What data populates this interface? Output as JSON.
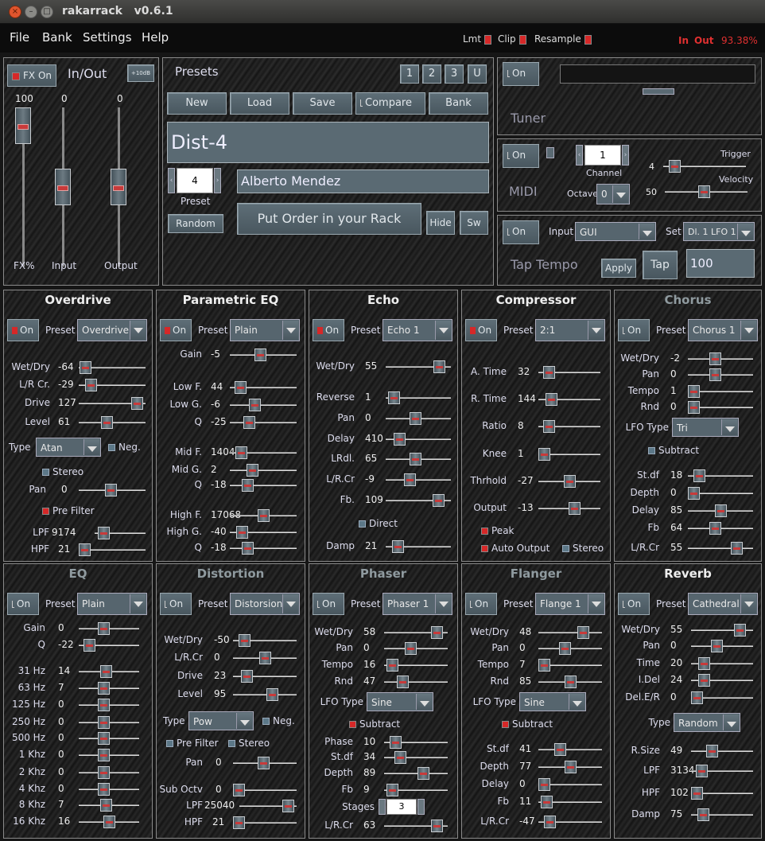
{
  "window": {
    "title": "rakarrack   v0.6.1",
    "close_glyph": "×",
    "min_glyph": "–",
    "max_glyph": "□"
  },
  "menu": [
    "File",
    "Bank",
    "Settings",
    "Help"
  ],
  "status": {
    "lmt": "Lmt",
    "clip": "Clip",
    "resample": "Resample",
    "in": "In",
    "out": "Out",
    "percent": "93.38%"
  },
  "inout": {
    "title": "In/Out",
    "fx_on": "FX On",
    "boost": "+10dB",
    "fx_val": "100",
    "input_val": "0",
    "output_val": "0",
    "fx_label": "FX%",
    "input_label": "Input",
    "output_label": "Output",
    "fx_level": 1.0,
    "input_level": 0.5,
    "output_level": 0.5
  },
  "presets": {
    "title": "Presets",
    "bank_buttons": [
      "1",
      "2",
      "3",
      "U"
    ],
    "new": "New",
    "load": "Load",
    "save": "Save",
    "compare": "Compare",
    "bank": "Bank",
    "name": "Dist-4",
    "number": "4",
    "preset_label": "Preset",
    "author": "Alberto Mendez",
    "random": "Random",
    "put_order": "Put Order in your Rack",
    "hide": "Hide",
    "sw": "Sw"
  },
  "tuner": {
    "on": "On",
    "label": "Tuner"
  },
  "midi": {
    "on": "On",
    "label": "MIDI",
    "channel": "1",
    "channel_label": "Channel",
    "octave_label": "Octave",
    "octave": "0",
    "trigger_label": "Trigger",
    "trigger": "4",
    "velocity_label": "Velocity",
    "velocity": "50"
  },
  "tap": {
    "on": "On",
    "input_label": "Input",
    "input": "GUI",
    "set_label": "Set",
    "set": "Dl. 1 LFO 1",
    "label": "Tap Tempo",
    "apply": "Apply",
    "tap": "Tap",
    "bpm": "100"
  },
  "effects_top": [
    {
      "title": "Overdrive",
      "dim": false,
      "preset": "Overdrive 1",
      "params": [
        {
          "l": "Wet/Dry",
          "v": "-64"
        },
        {
          "l": "L/R Cr.",
          "v": "-29"
        },
        {
          "l": "Drive",
          "v": "127"
        },
        {
          "l": "Level",
          "v": "61"
        }
      ],
      "type_label": "Type",
      "type": "Atan",
      "neg": "Neg.",
      "stereo": "Stereo",
      "pan_l": "Pan",
      "pan_v": "0",
      "prefilter": "Pre Filter",
      "lpf_l": "LPF",
      "lpf_v": "9174",
      "hpf_l": "HPF",
      "hpf_v": "21"
    },
    {
      "title": "Parametric EQ",
      "dim": false,
      "preset": "Plain",
      "params": [
        {
          "l": "Gain",
          "v": "-5"
        },
        {
          "l": "Low F.",
          "v": "44"
        },
        {
          "l": "Low G.",
          "v": "-6"
        },
        {
          "l": "Q",
          "v": "-25"
        },
        {
          "l": "Mid F.",
          "v": "1404"
        },
        {
          "l": "Mid G.",
          "v": "2"
        },
        {
          "l": "Q",
          "v": "-18"
        },
        {
          "l": "High F.",
          "v": "17068"
        },
        {
          "l": "High G.",
          "v": "-40"
        },
        {
          "l": "Q",
          "v": "-18"
        }
      ]
    },
    {
      "title": "Echo",
      "dim": false,
      "preset": "Echo 1",
      "params": [
        {
          "l": "Wet/Dry",
          "v": "55"
        },
        {
          "l": "Reverse",
          "v": "1"
        },
        {
          "l": "Pan",
          "v": "0"
        },
        {
          "l": "Delay",
          "v": "410"
        },
        {
          "l": "LRdl.",
          "v": "65"
        },
        {
          "l": "L/R.Cr",
          "v": "-9"
        },
        {
          "l": "Fb.",
          "v": "109"
        },
        {
          "l": "Damp",
          "v": "21"
        }
      ],
      "direct": "Direct"
    },
    {
      "title": "Compressor",
      "dim": false,
      "preset": "2:1",
      "params": [
        {
          "l": "A. Time",
          "v": "32"
        },
        {
          "l": "R. Time",
          "v": "144"
        },
        {
          "l": "Ratio",
          "v": "8"
        },
        {
          "l": "Knee",
          "v": "1"
        },
        {
          "l": "Thrhold",
          "v": "-27"
        },
        {
          "l": "Output",
          "v": "-13"
        }
      ],
      "peak": "Peak",
      "auto": "Auto Output",
      "stereo": "Stereo"
    },
    {
      "title": "Chorus",
      "dim": true,
      "preset": "Chorus 1",
      "params": [
        {
          "l": "Wet/Dry",
          "v": "-2"
        },
        {
          "l": "Pan",
          "v": "0"
        },
        {
          "l": "Tempo",
          "v": "1"
        },
        {
          "l": "Rnd",
          "v": "0"
        },
        {
          "l": "St.df",
          "v": "18"
        },
        {
          "l": "Depth",
          "v": "0"
        },
        {
          "l": "Delay",
          "v": "85"
        },
        {
          "l": "Fb",
          "v": "64"
        },
        {
          "l": "L/R.Cr",
          "v": "55"
        }
      ],
      "lfo_label": "LFO Type",
      "lfo": "Tri",
      "subtract": "Subtract"
    }
  ],
  "effects_bottom": [
    {
      "title": "EQ",
      "dim": true,
      "preset": "Plain",
      "params": [
        {
          "l": "Gain",
          "v": "0"
        },
        {
          "l": "Q",
          "v": "-22"
        },
        {
          "l": "31 Hz",
          "v": "14"
        },
        {
          "l": "63 Hz",
          "v": "7"
        },
        {
          "l": "125 Hz",
          "v": "0"
        },
        {
          "l": "250 Hz",
          "v": "0"
        },
        {
          "l": "500 Hz",
          "v": "0"
        },
        {
          "l": "1 Khz",
          "v": "0"
        },
        {
          "l": "2 Khz",
          "v": "0"
        },
        {
          "l": "4 Khz",
          "v": "0"
        },
        {
          "l": "8 Khz",
          "v": "7"
        },
        {
          "l": "16 Khz",
          "v": "16"
        }
      ]
    },
    {
      "title": "Distortion",
      "dim": true,
      "preset": "Distorsion 1",
      "params": [
        {
          "l": "Wet/Dry",
          "v": "-50"
        },
        {
          "l": "L/R.Cr",
          "v": "0"
        },
        {
          "l": "Drive",
          "v": "23"
        },
        {
          "l": "Level",
          "v": "95"
        }
      ],
      "type_label": "Type",
      "type": "Pow",
      "neg": "Neg.",
      "prefilter": "Pre Filter",
      "stereo": "Stereo",
      "pan_l": "Pan",
      "pan_v": "0",
      "sub_l": "Sub Octv",
      "sub_v": "0",
      "lpf_l": "LPF",
      "lpf_v": "25040",
      "hpf_l": "HPF",
      "hpf_v": "21"
    },
    {
      "title": "Phaser",
      "dim": true,
      "preset": "Phaser 1",
      "params": [
        {
          "l": "Wet/Dry",
          "v": "58"
        },
        {
          "l": "Pan",
          "v": "0"
        },
        {
          "l": "Tempo",
          "v": "16"
        },
        {
          "l": "Rnd",
          "v": "47"
        },
        {
          "l": "Phase",
          "v": "10"
        },
        {
          "l": "St.df",
          "v": "34"
        },
        {
          "l": "Depth",
          "v": "89"
        },
        {
          "l": "Fb",
          "v": "9"
        },
        {
          "l": "L/R.Cr",
          "v": "63"
        }
      ],
      "lfo_label": "LFO Type",
      "lfo": "Sine",
      "subtract": "Subtract",
      "stages_label": "Stages",
      "stages": "3"
    },
    {
      "title": "Flanger",
      "dim": true,
      "preset": "Flange 1",
      "params": [
        {
          "l": "Wet/Dry",
          "v": "48"
        },
        {
          "l": "Pan",
          "v": "0"
        },
        {
          "l": "Tempo",
          "v": "7"
        },
        {
          "l": "Rnd",
          "v": "85"
        },
        {
          "l": "St.df",
          "v": "41"
        },
        {
          "l": "Depth",
          "v": "77"
        },
        {
          "l": "Delay",
          "v": "0"
        },
        {
          "l": "Fb",
          "v": "11"
        },
        {
          "l": "L/R.Cr",
          "v": "-47"
        }
      ],
      "lfo_label": "LFO Type",
      "lfo": "Sine",
      "subtract": "Subtract"
    },
    {
      "title": "Reverb",
      "dim": false,
      "preset": "Cathedral 1",
      "params": [
        {
          "l": "Wet/Dry",
          "v": "55"
        },
        {
          "l": "Pan",
          "v": "0"
        },
        {
          "l": "Time",
          "v": "20"
        },
        {
          "l": "I.Del",
          "v": "24"
        },
        {
          "l": "Del.E/R",
          "v": "0"
        },
        {
          "l": "R.Size",
          "v": "49"
        },
        {
          "l": "LPF",
          "v": "3134"
        },
        {
          "l": "HPF",
          "v": "102"
        },
        {
          "l": "Damp",
          "v": "75"
        }
      ],
      "type_label": "Type",
      "type": "Random"
    }
  ],
  "on_label": "On",
  "preset_label": "Preset",
  "colors": {
    "led_on": "#d62828",
    "led_off": "#5c7888",
    "accent_red": "#e03030"
  }
}
